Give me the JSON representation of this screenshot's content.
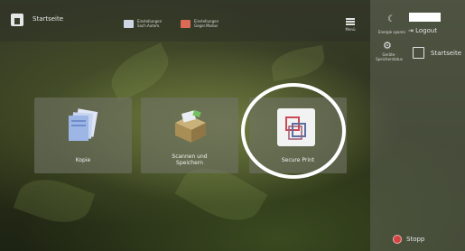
{
  "header": {
    "home_label": "Startseite",
    "shortcut1_line1": "Einstellungen",
    "shortcut1_line2": "Sach.Autom.",
    "shortcut2_line1": "Einstellungen",
    "shortcut2_line2": "Geger.Modus",
    "menu_label": "Menü"
  },
  "right_panel": {
    "energy_label": "Energie sparen",
    "logout_label": "Logout",
    "settings_line1": "Geräte-",
    "settings_line2": "Speicherstatus",
    "home_label": "Startseite",
    "stop_label": "Stopp"
  },
  "tiles": [
    {
      "label": "Kopie",
      "icon": "copy-icon"
    },
    {
      "label_line1": "Scannen und",
      "label_line2": "Speichern",
      "icon": "scan-save-icon"
    },
    {
      "label": "Secure Print",
      "icon": "secure-print-icon"
    }
  ],
  "colors": {
    "accent_red": "#d24545",
    "highlight": "#ffffff"
  }
}
